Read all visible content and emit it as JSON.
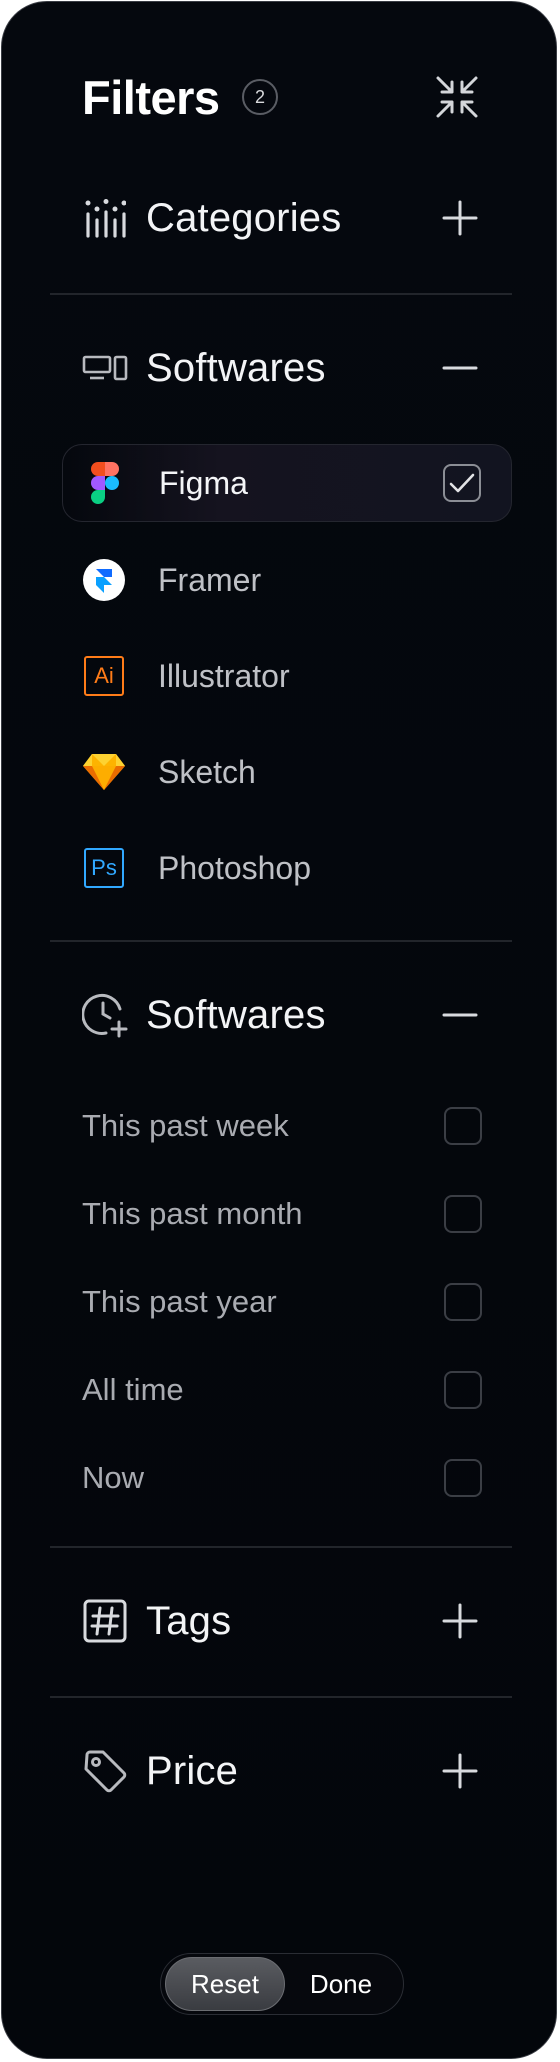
{
  "header": {
    "title": "Filters",
    "count": "2",
    "collapse_icon": "collapse-arrows-icon"
  },
  "sections": {
    "categories": {
      "title": "Categories",
      "icon": "categories-bars-icon",
      "state": "collapsed"
    },
    "softwares": {
      "title": "Softwares",
      "icon": "devices-icon",
      "state": "expanded"
    },
    "time": {
      "title": "Softwares",
      "icon": "clock-plus-icon",
      "state": "expanded"
    },
    "tags": {
      "title": "Tags",
      "icon": "hashtag-icon",
      "state": "collapsed"
    },
    "price": {
      "title": "Price",
      "icon": "price-tag-icon",
      "state": "collapsed"
    }
  },
  "software_items": [
    {
      "label": "Figma",
      "icon": "figma-logo-icon",
      "checked": true
    },
    {
      "label": "Framer",
      "icon": "framer-logo-icon",
      "checked": false
    },
    {
      "label": "Illustrator",
      "icon": "illustrator-logo-icon",
      "logo_text": "Ai",
      "checked": false
    },
    {
      "label": "Sketch",
      "icon": "sketch-logo-icon",
      "checked": false
    },
    {
      "label": "Photoshop",
      "icon": "photoshop-logo-icon",
      "logo_text": "Ps",
      "checked": false
    }
  ],
  "time_items": [
    {
      "label": "This past week",
      "checked": false
    },
    {
      "label": "This past month",
      "checked": false
    },
    {
      "label": "This past year",
      "checked": false
    },
    {
      "label": "All time",
      "checked": false
    },
    {
      "label": "Now",
      "checked": false
    }
  ],
  "footer": {
    "reset_label": "Reset",
    "done_label": "Done"
  },
  "colors": {
    "background": "#04070c",
    "border": "#3a3d44",
    "illustrator": "#ff7c18",
    "photoshop": "#31a8ff",
    "sketch": "#fdb300"
  }
}
